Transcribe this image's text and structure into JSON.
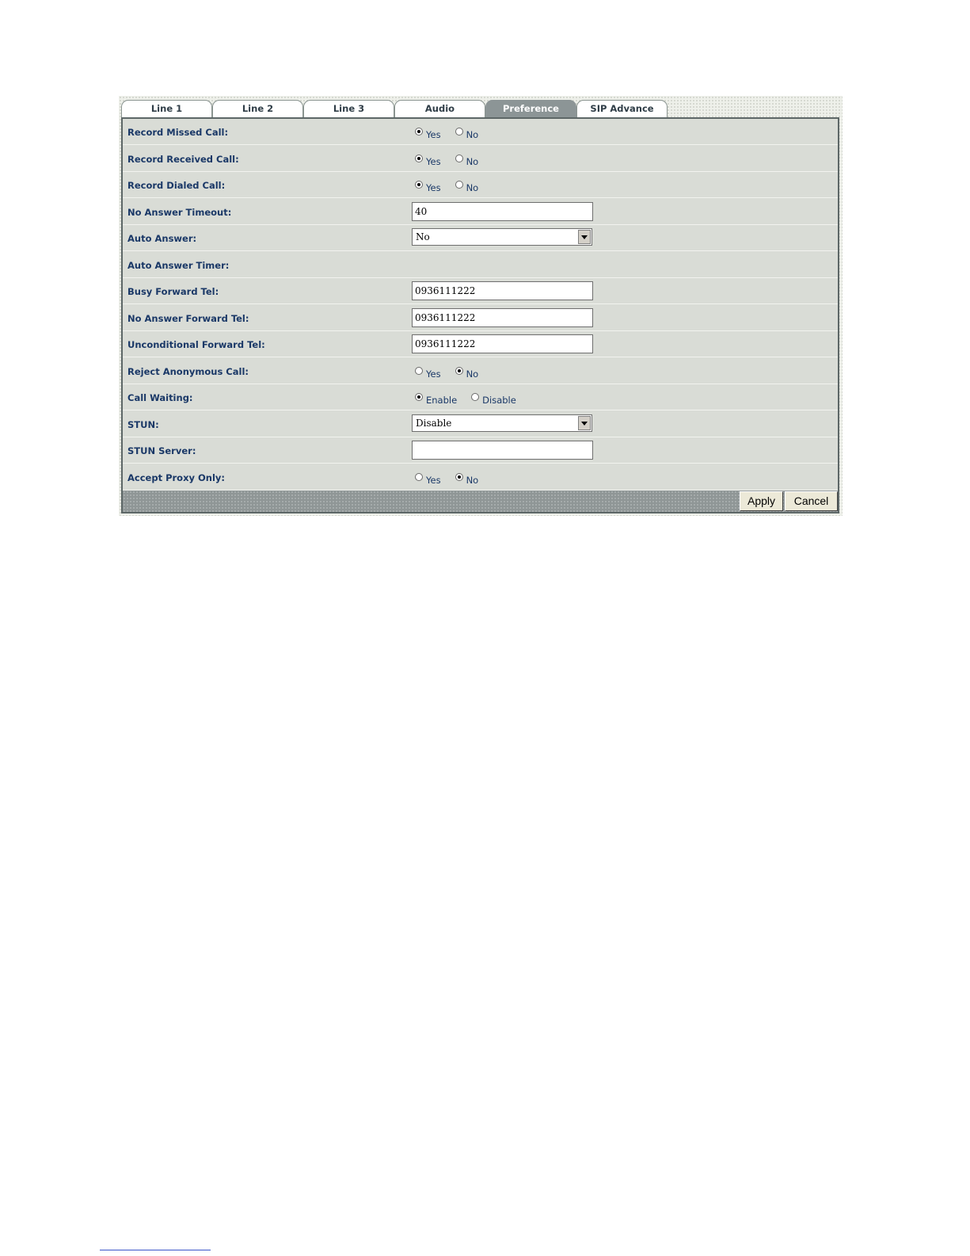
{
  "tabs": [
    {
      "label": "Line 1",
      "active": false
    },
    {
      "label": "Line 2",
      "active": false
    },
    {
      "label": "Line 3",
      "active": false
    },
    {
      "label": "Audio",
      "active": false
    },
    {
      "label": "Preference",
      "active": true
    },
    {
      "label": "SIP Advance",
      "active": false
    }
  ],
  "rows": [
    {
      "label": "Record Missed Call:",
      "type": "radio",
      "options": [
        "Yes",
        "No"
      ],
      "selected": 0
    },
    {
      "label": "Record Received Call:",
      "type": "radio",
      "options": [
        "Yes",
        "No"
      ],
      "selected": 0
    },
    {
      "label": "Record Dialed Call:",
      "type": "radio",
      "options": [
        "Yes",
        "No"
      ],
      "selected": 0
    },
    {
      "label": "No Answer Timeout:",
      "type": "text",
      "value": "40"
    },
    {
      "label": "Auto Answer:",
      "type": "select",
      "value": "No"
    },
    {
      "label": "Auto Answer Timer:",
      "type": "none"
    },
    {
      "label": "Busy Forward Tel:",
      "type": "text",
      "value": "0936111222"
    },
    {
      "label": "No Answer Forward Tel:",
      "type": "text",
      "value": "0936111222"
    },
    {
      "label": "Unconditional Forward Tel:",
      "type": "text",
      "value": "0936111222"
    },
    {
      "label": "Reject Anonymous Call:",
      "type": "radio",
      "options": [
        "Yes",
        "No"
      ],
      "selected": 1
    },
    {
      "label": "Call Waiting:",
      "type": "radio",
      "options": [
        "Enable",
        "Disable"
      ],
      "selected": 0
    },
    {
      "label": "STUN:",
      "type": "select",
      "value": "Disable"
    },
    {
      "label": "STUN Server:",
      "type": "text",
      "value": ""
    },
    {
      "label": "Accept Proxy Only:",
      "type": "radio",
      "options": [
        "Yes",
        "No"
      ],
      "selected": 1
    }
  ],
  "buttons": {
    "apply": "Apply",
    "cancel": "Cancel"
  }
}
